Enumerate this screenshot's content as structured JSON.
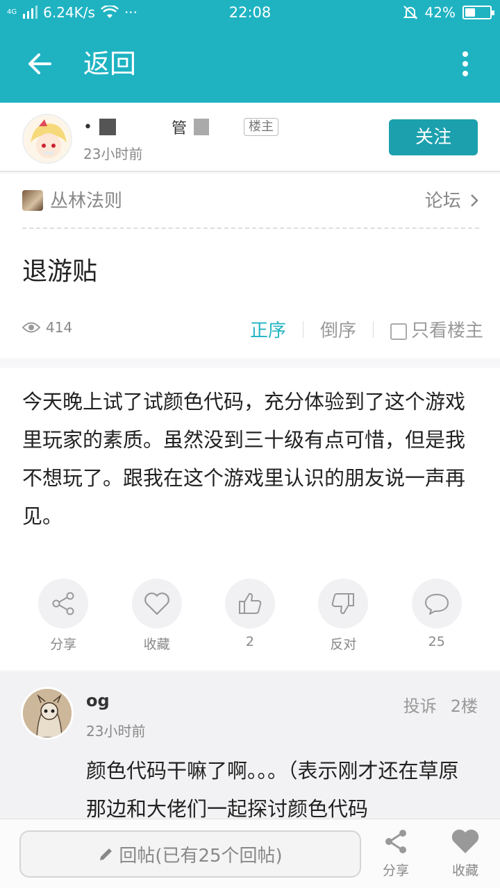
{
  "status_bar": {
    "network": "4G",
    "speed": "6.24K/s",
    "dots": "···",
    "time": "22:08",
    "battery": "42%",
    "battery_level": 0.42
  },
  "header": {
    "title": "返回"
  },
  "author": {
    "name_fragment_1": "•",
    "name_fragment_2": "管",
    "badge": "楼主",
    "time": "23小时前",
    "follow_label": "关注"
  },
  "forum": {
    "name": "丛林法则",
    "link_label": "论坛"
  },
  "post": {
    "title": "退游贴",
    "views": "414",
    "sort_asc": "正序",
    "sort_desc": "倒序",
    "owner_only": "只看楼主",
    "body": "今天晚上试了试颜色代码，充分体验到了这个游戏里玩家的素质。虽然没到三十级有点可惜，但是我不想玩了。跟我在这个游戏里认识的朋友说一声再见。"
  },
  "actions": [
    {
      "label": "分享",
      "icon": "share-icon"
    },
    {
      "label": "收藏",
      "icon": "heart-icon"
    },
    {
      "label": "2",
      "icon": "thumbs-up-icon"
    },
    {
      "label": "反对",
      "icon": "thumbs-down-icon"
    },
    {
      "label": "25",
      "icon": "comment-icon"
    }
  ],
  "reply": {
    "name": "og",
    "time": "23小时前",
    "report_label": "投诉",
    "floor": "2楼",
    "text": "颜色代码干嘛了啊。。。（表示刚才还在草原那边和大佬们一起探讨颜色代码"
  },
  "bottom_bar": {
    "reply_placeholder": "回帖(已有25个回帖)",
    "share_label": "分享",
    "favorite_label": "收藏"
  },
  "colors": {
    "accent": "#1fb3c2",
    "follow_button": "#1ca0ad"
  }
}
